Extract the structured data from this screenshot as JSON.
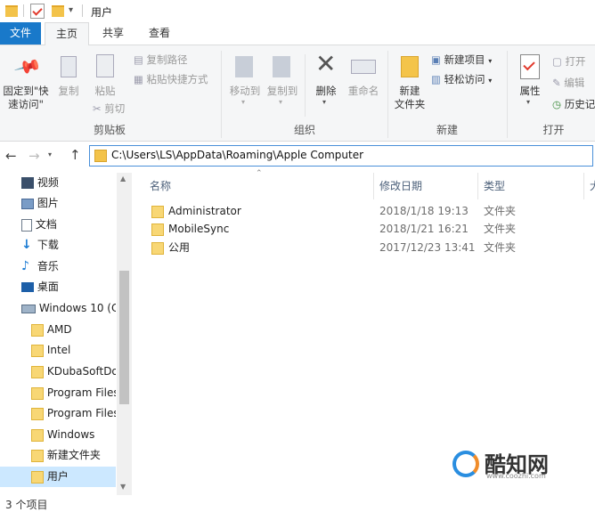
{
  "window": {
    "title": "用户"
  },
  "tabs": [
    "文件",
    "主页",
    "共享",
    "查看"
  ],
  "ribbon": {
    "pin": "固定到\"快速访问\"",
    "copy": "复制",
    "paste": "粘贴",
    "copy_path": "复制路径",
    "paste_shortcut": "粘贴快捷方式",
    "cut": "剪切",
    "clipboard_group": "剪贴板",
    "move_to": "移动到",
    "copy_to": "复制到",
    "delete": "删除",
    "rename": "重命名",
    "organize_group": "组织",
    "new_folder": "新建\n文件夹",
    "new_item": "新建项目",
    "easy_access": "轻松访问",
    "new_group": "新建",
    "properties": "属性",
    "open": "打开",
    "edit": "编辑",
    "history": "历史记",
    "open_group": "打开"
  },
  "address": {
    "path": "C:\\Users\\LS\\AppData\\Roaming\\Apple Computer"
  },
  "nav": [
    {
      "label": "视频",
      "icon": "video-icon"
    },
    {
      "label": "图片",
      "icon": "pictures-icon"
    },
    {
      "label": "文档",
      "icon": "documents-icon"
    },
    {
      "label": "下载",
      "icon": "download-icon"
    },
    {
      "label": "音乐",
      "icon": "music-icon"
    },
    {
      "label": "桌面",
      "icon": "desktop-icon"
    },
    {
      "label": "Windows 10 (C",
      "icon": "drive-icon"
    },
    {
      "label": "AMD",
      "icon": "folder-icon"
    },
    {
      "label": "Intel",
      "icon": "folder-icon"
    },
    {
      "label": "KDubaSoftDo",
      "icon": "folder-icon"
    },
    {
      "label": "Program Files",
      "icon": "folder-icon"
    },
    {
      "label": "Program Files",
      "icon": "folder-icon"
    },
    {
      "label": "Windows",
      "icon": "folder-icon"
    },
    {
      "label": "新建文件夹",
      "icon": "folder-icon"
    },
    {
      "label": "用户",
      "icon": "folder-icon"
    }
  ],
  "columns": {
    "name": "名称",
    "date": "修改日期",
    "type": "类型",
    "size": "大"
  },
  "files": [
    {
      "name": "Administrator",
      "date": "2018/1/18 19:13",
      "type": "文件夹"
    },
    {
      "name": "MobileSync",
      "date": "2018/1/21 16:21",
      "type": "文件夹"
    },
    {
      "name": "公用",
      "date": "2017/12/23 13:41",
      "type": "文件夹"
    }
  ],
  "status": {
    "count": "3 个项目"
  },
  "watermark": {
    "brand": "酷知网",
    "url": "www.coozhi.com"
  }
}
